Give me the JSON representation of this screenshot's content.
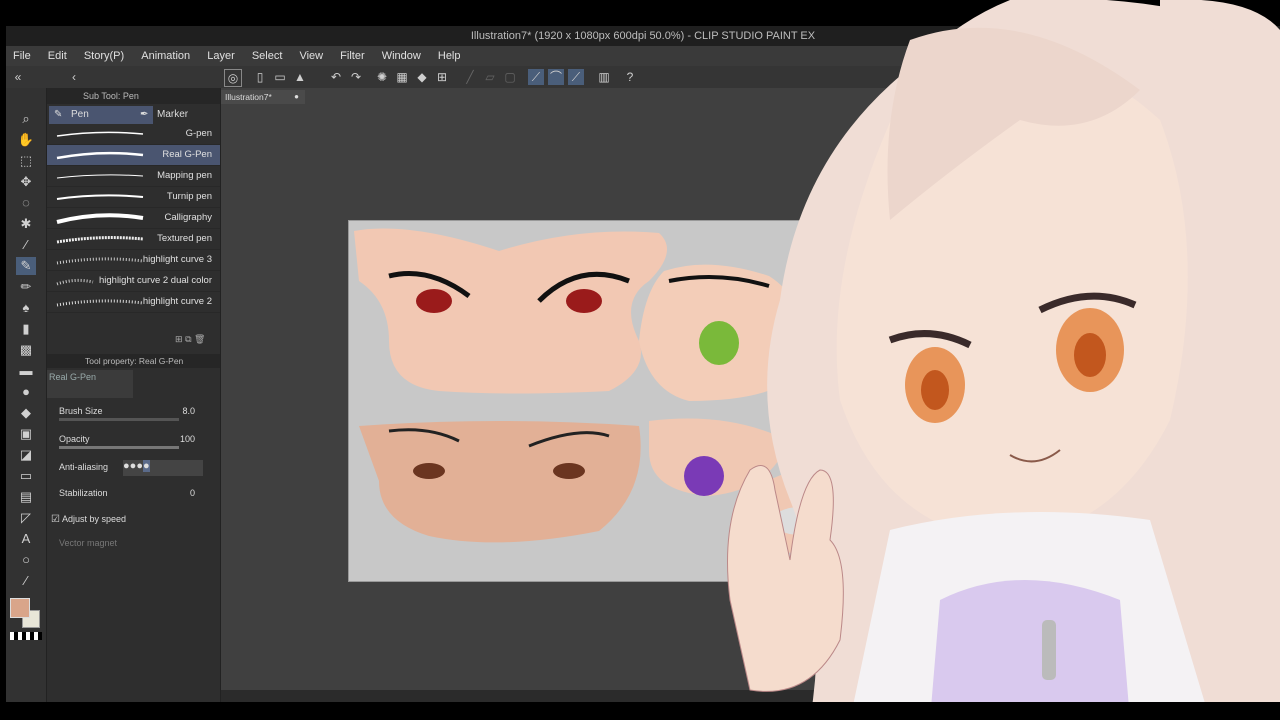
{
  "window": {
    "title": "Illustration7* (1920 x 1080px 600dpi 50.0%) - CLIP STUDIO PAINT EX"
  },
  "menu": [
    "File",
    "Edit",
    "Story(P)",
    "Animation",
    "Layer",
    "Select",
    "View",
    "Filter",
    "Window",
    "Help"
  ],
  "subtool_panel": {
    "header": "Sub Tool: Pen",
    "tabs": [
      "Pen",
      "Marker"
    ],
    "brushes": [
      {
        "label": "G-pen"
      },
      {
        "label": "Real G-Pen",
        "selected": true
      },
      {
        "label": "Mapping pen"
      },
      {
        "label": "Turnip pen"
      },
      {
        "label": "Calligraphy"
      },
      {
        "label": "Textured pen"
      },
      {
        "label": "highlight curve 3"
      },
      {
        "label": "highlight curve 2 dual color"
      },
      {
        "label": "highlight curve 2"
      }
    ]
  },
  "tool_property": {
    "header": "Tool property: Real G-Pen",
    "preview_label": "Real G-Pen",
    "brush_size": {
      "label": "Brush Size",
      "value": "8.0"
    },
    "opacity": {
      "label": "Opacity",
      "value": "100"
    },
    "anti_aliasing": {
      "label": "Anti-aliasing"
    },
    "stabilization": {
      "label": "Stabilization",
      "value": "0"
    },
    "adjust_by_speed": {
      "label": "Adjust by speed",
      "checked": true
    },
    "vector_magnet": {
      "label": "Vector magnet"
    }
  },
  "document_tab": {
    "label": "Illustration7*"
  },
  "colors": {
    "main": "#d9a58a",
    "sub": "#e8e6d8",
    "accent": "#4a5e7a"
  }
}
